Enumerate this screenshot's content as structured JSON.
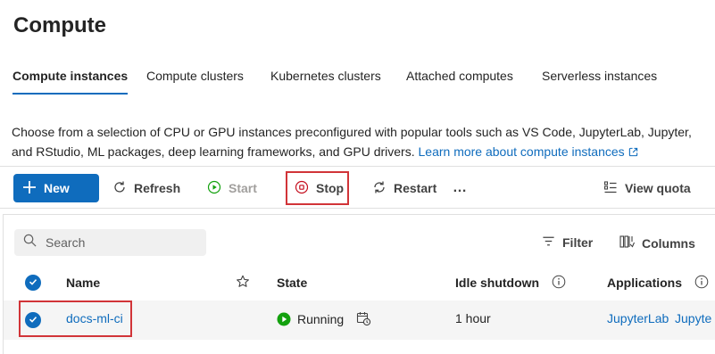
{
  "page": {
    "title": "Compute"
  },
  "tabs": [
    {
      "label": "Compute instances",
      "active": true
    },
    {
      "label": "Compute clusters",
      "active": false
    },
    {
      "label": "Kubernetes clusters",
      "active": false
    },
    {
      "label": "Attached computes",
      "active": false
    },
    {
      "label": "Serverless instances",
      "active": false
    }
  ],
  "description": {
    "text": "Choose from a selection of CPU or GPU instances preconfigured with popular tools such as VS Code, JupyterLab, Jupyter, and RStudio, ML packages, deep learning frameworks, and GPU drivers. ",
    "link": "Learn more about compute instances"
  },
  "toolbar": {
    "new_label": "New",
    "refresh_label": "Refresh",
    "start_label": "Start",
    "stop_label": "Stop",
    "restart_label": "Restart",
    "more_label": "…",
    "view_quota_label": "View quota"
  },
  "grid": {
    "search_placeholder": "Search",
    "filter_label": "Filter",
    "columns_label": "Columns",
    "headers": {
      "name": "Name",
      "state": "State",
      "idle_shutdown": "Idle shutdown",
      "applications": "Applications"
    },
    "rows": [
      {
        "name": "docs-ml-ci",
        "state": "Running",
        "idle_shutdown": "1 hour",
        "app1": "JupyterLab",
        "app2": "Jupyte"
      }
    ]
  },
  "colors": {
    "accent": "#0f6cbd",
    "running": "#13a10e",
    "highlight": "#d13438"
  }
}
